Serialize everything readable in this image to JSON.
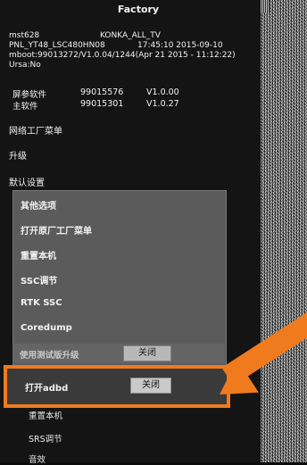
{
  "title": "Factory",
  "info": {
    "model_board": "mst628",
    "brand": "KONKA_ALL_TV",
    "panel": "PNL_YT48_LSC480HN08",
    "time": "17:45:10 2015-09-10",
    "mboot": "mboot:99013272/V1.0.04/1244(Apr 21 2015 - 11:12:22)",
    "ursa": "Ursa:No"
  },
  "firmware": [
    {
      "label": "屏参软件",
      "code": "99015576",
      "version": "V1.0.00"
    },
    {
      "label": "主软件",
      "code": "99015301",
      "version": "V1.0.27"
    }
  ],
  "menu": [
    {
      "label": "网络工厂菜单"
    },
    {
      "label": "升级"
    },
    {
      "label": "默认设置"
    }
  ],
  "dropdown": {
    "items": [
      {
        "label": "其他选项"
      },
      {
        "label": "打开原厂工厂菜单"
      },
      {
        "label": "重置本机"
      },
      {
        "label": "SSC调节"
      },
      {
        "label": "RTK SSC"
      },
      {
        "label": "Coredump"
      }
    ],
    "partial_row": {
      "label": "使用测试版升级",
      "value": "关闭"
    },
    "adbd_row": {
      "label": "打开adbd",
      "value": "关闭"
    }
  },
  "below": [
    {
      "label": "重置本机"
    },
    {
      "label": "SRS调节"
    },
    {
      "label": "音效"
    }
  ],
  "colors": {
    "highlight": "#f07a1e",
    "panel": "#141414",
    "dropdown": "#5b5b5b"
  }
}
